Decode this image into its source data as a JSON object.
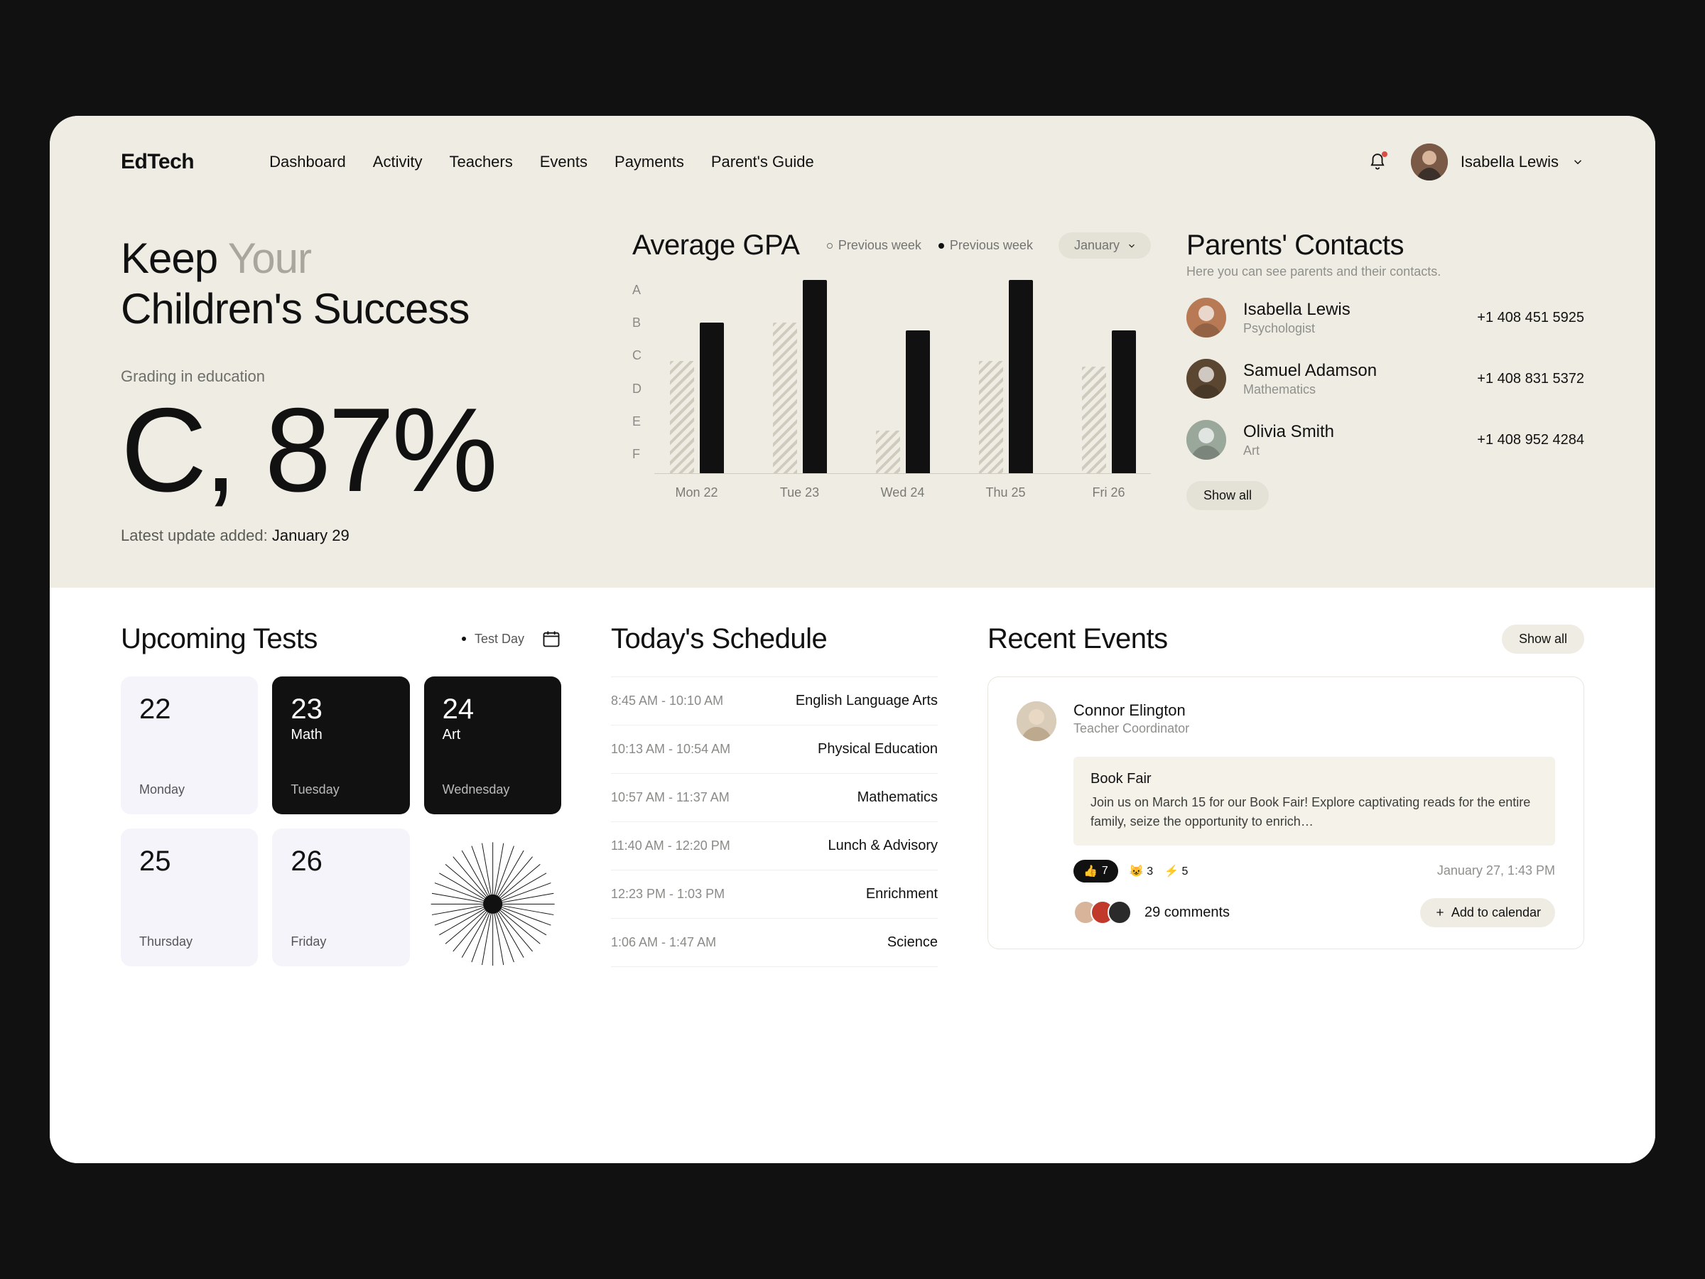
{
  "brand": "EdTech",
  "nav": [
    "Dashboard",
    "Activity",
    "Teachers",
    "Events",
    "Payments",
    "Parent's Guide"
  ],
  "user": {
    "name": "Isabella Lewis"
  },
  "headline": {
    "pre": "Keep ",
    "muted": "Your",
    "post": "Children's Success"
  },
  "grading": {
    "label": "Grading in education",
    "value": "C, 87%"
  },
  "latest": {
    "prefix": "Latest update added: ",
    "date": "January 29"
  },
  "chart_data": {
    "type": "bar",
    "title": "Average GPA",
    "legend_a": "Previous week",
    "legend_b": "Previous week",
    "month": "January",
    "y_categories": [
      "A",
      "B",
      "C",
      "D",
      "E",
      "F"
    ],
    "categories": [
      "Mon 22",
      "Tue 23",
      "Wed 24",
      "Thu 25",
      "Fri 26"
    ],
    "series": [
      {
        "name": "previous",
        "grades": [
          "C",
          "B",
          "E",
          "C",
          "C"
        ],
        "heights": [
          58,
          78,
          22,
          58,
          55
        ]
      },
      {
        "name": "current",
        "grades": [
          "B",
          "A",
          "B",
          "A",
          "B"
        ],
        "heights": [
          78,
          100,
          74,
          100,
          74
        ]
      }
    ]
  },
  "contacts": {
    "title": "Parents' Contacts",
    "sub": "Here you can see parents and their contacts.",
    "items": [
      {
        "name": "Isabella Lewis",
        "role": "Psychologist",
        "phone": "+1 408 451 5925",
        "bg": "#b87a54"
      },
      {
        "name": "Samuel Adamson",
        "role": "Mathematics",
        "phone": "+1 408 831 5372",
        "bg": "#5b4631"
      },
      {
        "name": "Olivia Smith",
        "role": "Art",
        "phone": "+1 408 952 4284",
        "bg": "#9aa79b"
      }
    ],
    "showall": "Show all"
  },
  "tests": {
    "title": "Upcoming Tests",
    "legend": "Test Day",
    "days": [
      {
        "num": "22",
        "subj": "",
        "day": "Monday",
        "variant": "light"
      },
      {
        "num": "23",
        "subj": "Math",
        "day": "Tuesday",
        "variant": "dark"
      },
      {
        "num": "24",
        "subj": "Art",
        "day": "Wednesday",
        "variant": "dark"
      },
      {
        "num": "25",
        "subj": "",
        "day": "Thursday",
        "variant": "light"
      },
      {
        "num": "26",
        "subj": "",
        "day": "Friday",
        "variant": "light"
      }
    ]
  },
  "schedule": {
    "title": "Today's Schedule",
    "rows": [
      {
        "time": "8:45 AM - 10:10 AM",
        "subj": "English Language Arts"
      },
      {
        "time": "10:13 AM - 10:54 AM",
        "subj": "Physical Education"
      },
      {
        "time": "10:57 AM - 11:37 AM",
        "subj": "Mathematics"
      },
      {
        "time": "11:40 AM - 12:20 PM",
        "subj": "Lunch & Advisory"
      },
      {
        "time": "12:23 PM - 1:03 PM",
        "subj": "Enrichment"
      },
      {
        "time": "1:06 AM - 1:47 AM",
        "subj": "Science"
      }
    ]
  },
  "events": {
    "title": "Recent Events",
    "showall": "Show all",
    "card": {
      "author": "Connor Elington",
      "role": "Teacher Coordinator",
      "postTitle": "Book Fair",
      "postBody": "Join us on March 15 for our Book Fair! Explore captivating reads for the entire family, seize the opportunity to enrich…",
      "react1_emoji": "👍",
      "react1_count": "7",
      "react2": "😺 3",
      "react3": "⚡ 5",
      "date": "January 27, 1:43 PM",
      "comments": "29 comments",
      "addcal": "Add to calendar"
    }
  }
}
